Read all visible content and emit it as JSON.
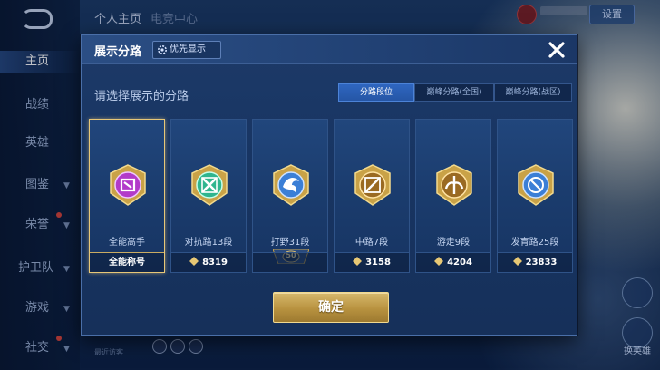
{
  "top": {
    "tab_profile": "个人主页",
    "tab_second": "电竞中心",
    "settings_label": "设置"
  },
  "nav": {
    "items": [
      "主页",
      "战绩",
      "英雄",
      "图鉴",
      "荣誉",
      "护卫队",
      "游戏",
      "社交"
    ]
  },
  "modal": {
    "title": "展示分路",
    "priority_label": "优先显示",
    "subtitle": "请选择展示的分路",
    "segments": [
      "分路段位",
      "巅峰分路(全国)",
      "巅峰分路(战区)"
    ],
    "active_segment": 0,
    "cards": [
      {
        "title": "全能高手",
        "foot": "全能称号",
        "points": "",
        "icon": "allround-badge-icon",
        "color": "#b23bc9"
      },
      {
        "title": "对抗路13段",
        "foot": "",
        "points": "8319",
        "icon": "clash-lane-badge-icon",
        "color": "#2fb58e"
      },
      {
        "title": "打野31段",
        "foot": "",
        "points": "",
        "level": "50",
        "icon": "jungle-badge-icon",
        "color": "#3b7fd6"
      },
      {
        "title": "中路7段",
        "foot": "",
        "points": "3158",
        "icon": "mid-lane-badge-icon",
        "color": "#c8952f"
      },
      {
        "title": "游走9段",
        "foot": "",
        "points": "4204",
        "icon": "roam-badge-icon",
        "color": "#c8952f"
      },
      {
        "title": "发育路25段",
        "foot": "",
        "points": "23833",
        "icon": "farm-lane-badge-icon",
        "color": "#3b7fd6"
      }
    ],
    "confirm_label": "确定"
  },
  "bottom": {
    "hint": "最近访客",
    "right_label": "换英雄"
  }
}
